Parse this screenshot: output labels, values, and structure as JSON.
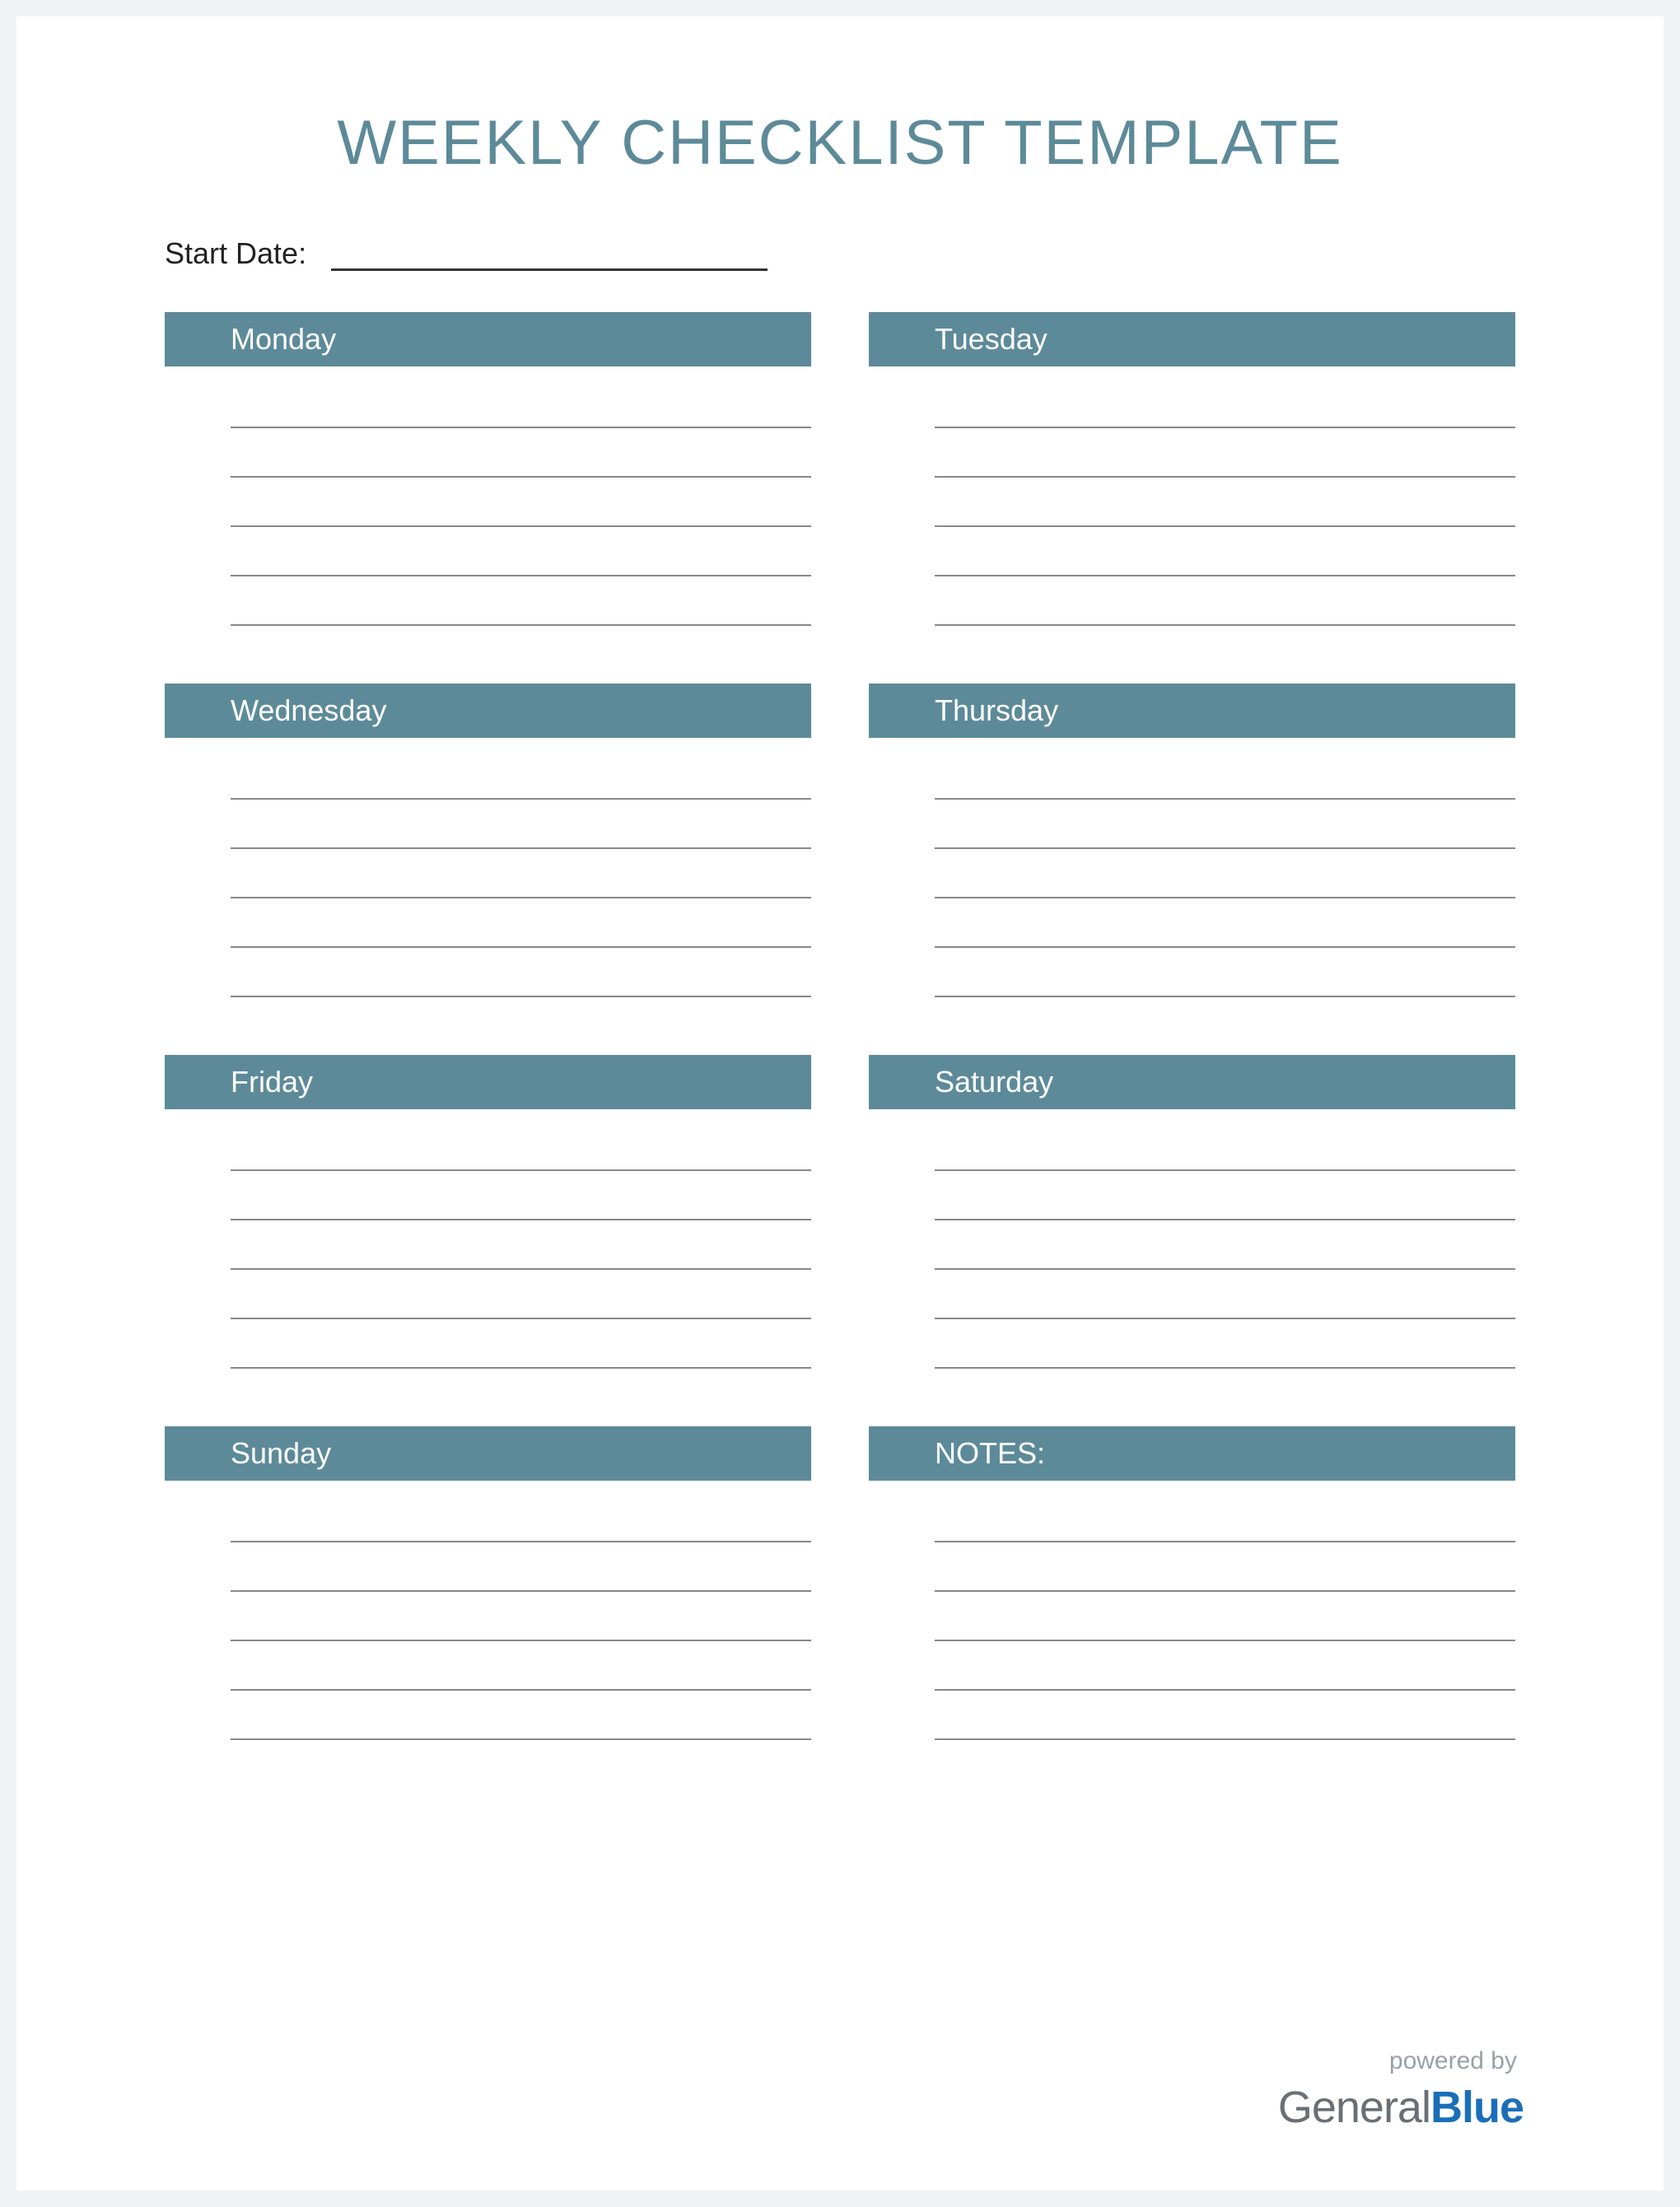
{
  "title": "WEEKLY CHECKLIST TEMPLATE",
  "start_label": "Start Date:",
  "blocks": [
    {
      "label": "Monday"
    },
    {
      "label": "Tuesday"
    },
    {
      "label": "Wednesday"
    },
    {
      "label": "Thursday"
    },
    {
      "label": "Friday"
    },
    {
      "label": "Saturday"
    },
    {
      "label": "Sunday"
    },
    {
      "label": "NOTES:"
    }
  ],
  "footer": {
    "powered": "powered by",
    "brand1": "General",
    "brand2": "Blue"
  },
  "colors": {
    "accent": "#5d8a99",
    "brand_blue": "#1a6fb8",
    "brand_gray": "#6a6f75"
  }
}
